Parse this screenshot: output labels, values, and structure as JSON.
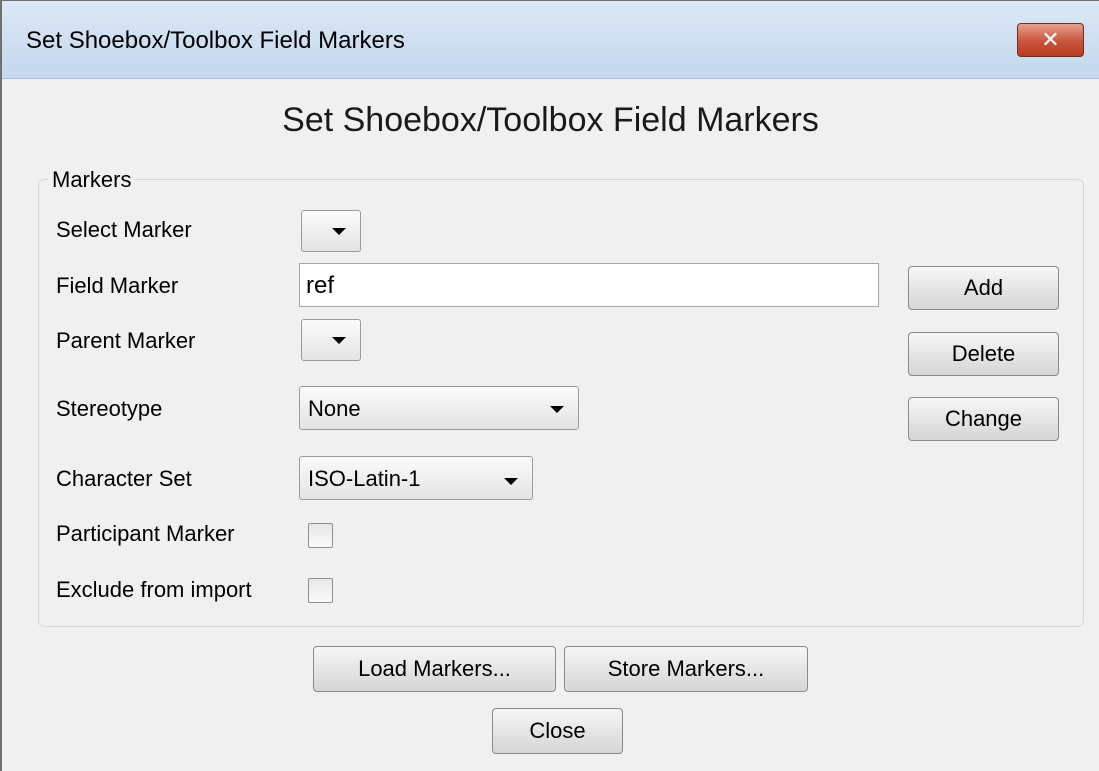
{
  "window": {
    "title": "Set Shoebox/Toolbox Field Markers",
    "close_glyph": "✕"
  },
  "heading": "Set Shoebox/Toolbox Field Markers",
  "markers_group": {
    "label": "Markers",
    "select_marker": {
      "label": "Select Marker",
      "value": ""
    },
    "field_marker": {
      "label": "Field Marker",
      "value": "ref"
    },
    "parent_marker": {
      "label": "Parent Marker",
      "value": ""
    },
    "stereotype": {
      "label": "Stereotype",
      "value": "None"
    },
    "character_set": {
      "label": "Character Set",
      "value": "ISO-Latin-1"
    },
    "participant_marker": {
      "label": "Participant Marker",
      "checked": false
    },
    "exclude_from_import": {
      "label": "Exclude from import",
      "checked": false
    }
  },
  "side_buttons": {
    "add": "Add",
    "delete": "Delete",
    "change": "Change"
  },
  "bottom_buttons": {
    "load": "Load Markers...",
    "store": "Store Markers...",
    "close": "Close"
  }
}
